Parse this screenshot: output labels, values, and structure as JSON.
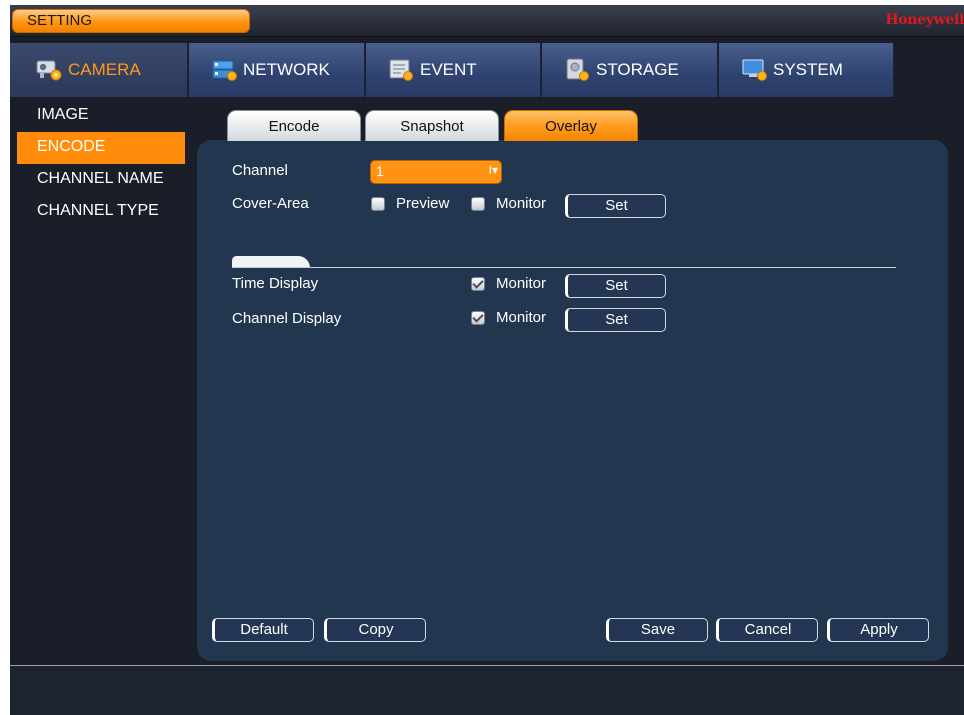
{
  "title": "SETTING",
  "brand": "Honeywell",
  "main_tabs": [
    {
      "label": "CAMERA",
      "icon": "camera-gear-icon",
      "active": true
    },
    {
      "label": "NETWORK",
      "icon": "network-gear-icon",
      "active": false
    },
    {
      "label": "EVENT",
      "icon": "event-gear-icon",
      "active": false
    },
    {
      "label": "STORAGE",
      "icon": "storage-gear-icon",
      "active": false
    },
    {
      "label": "SYSTEM",
      "icon": "system-gear-icon",
      "active": false
    }
  ],
  "sidebar": {
    "items": [
      {
        "label": "IMAGE",
        "active": false
      },
      {
        "label": "ENCODE",
        "active": true
      },
      {
        "label": "CHANNEL NAME",
        "active": false
      },
      {
        "label": "CHANNEL TYPE",
        "active": false
      }
    ]
  },
  "sub_tabs": [
    {
      "label": "Encode",
      "active": false
    },
    {
      "label": "Snapshot",
      "active": false
    },
    {
      "label": "Overlay",
      "active": true
    }
  ],
  "overlay": {
    "channel_label": "Channel",
    "channel_value": "1",
    "channel_arrow": "I▾",
    "cover_area_label": "Cover-Area",
    "preview_label": "Preview",
    "preview_checked": false,
    "cover_monitor_label": "Monitor",
    "cover_monitor_checked": false,
    "cover_set_label": "Set",
    "time_display_label": "Time Display",
    "time_monitor_label": "Monitor",
    "time_monitor_checked": true,
    "time_set_label": "Set",
    "channel_display_label": "Channel Display",
    "channel_monitor_label": "Monitor",
    "channel_monitor_checked": true,
    "channel_set_label": "Set"
  },
  "footer": {
    "default_label": "Default",
    "copy_label": "Copy",
    "save_label": "Save",
    "cancel_label": "Cancel",
    "apply_label": "Apply"
  },
  "colors": {
    "accent": "#ff8c0a",
    "brand": "#e01a1a",
    "panel": "#233650",
    "background": "#1a1e29"
  }
}
